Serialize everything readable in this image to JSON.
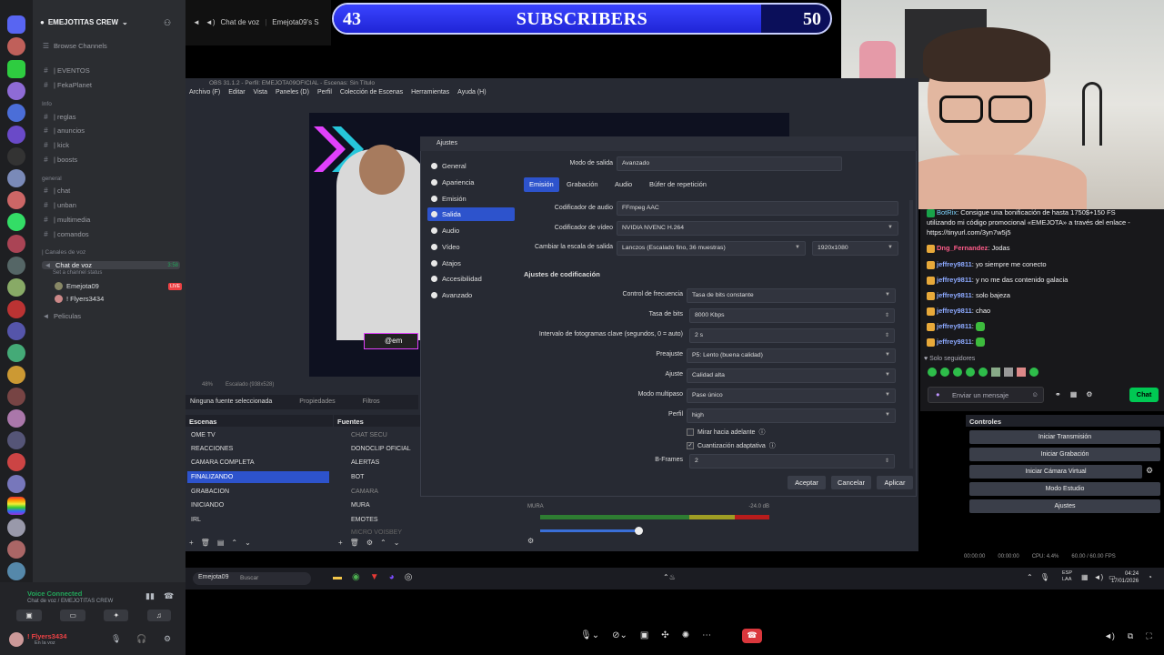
{
  "discord": {
    "server_name": "EMEJOTITAS CREW",
    "browse_channels": "Browse Channels",
    "channels_top": [
      "| EVENTOS",
      "| FekaPlanet"
    ],
    "cat_info": "Info",
    "channels_info": [
      "| reglas",
      "| anuncios",
      "| kick",
      "| boosts"
    ],
    "cat_general": "general",
    "channels_general": [
      "| chat",
      "| unban",
      "| multimedia",
      "| comandos"
    ],
    "cat_voice": "| Canales de voz",
    "voice_channel": "Chat de voz",
    "voice_channel_time": "3:58",
    "channel_status": "Set a channel status",
    "voice_users": [
      {
        "name": "Emejota09",
        "badge": "LIVE"
      },
      {
        "name": "! Flyers3434",
        "badge": ""
      }
    ],
    "extra_channel": "Peliculas",
    "voice_connected": "Voice Connected",
    "voice_path": "Chat de voz / EMEJOTITAS CREW",
    "self_name": "! Flyers3434",
    "self_status": "En la voz"
  },
  "call_bar": {
    "title": "Chat de voz",
    "user": "Emejota09's S"
  },
  "subs_goal": {
    "label": "SUBSCRIBERS",
    "current": "43",
    "target": "50",
    "progress": 0.86
  },
  "obs": {
    "title": "OBS 31.1.2 - Perfil: EMEJOTA09OFICIAL - Escenas: Sin Título",
    "menu": [
      "Archivo (F)",
      "Editar",
      "Vista",
      "Paneles (D)",
      "Perfil",
      "Colección de Escenas",
      "Herramientas",
      "Ayuda (H)"
    ],
    "scale_info": "Escalado (938x528)",
    "zoom": "48%",
    "no_source": "Ninguna fuente seleccionada",
    "properties": "Propiedades",
    "filters": "Filtros",
    "scenes_header": "Escenas",
    "scenes": [
      "OME TV",
      "REACCIONES",
      "CAMARA COMPLETA",
      "FINALIZANDO",
      "GRABACION",
      "INICIANDO",
      "IRL"
    ],
    "selected_scene": "FINALIZANDO",
    "sources_header": "Fuentes",
    "sources": [
      "CHAT SECU",
      "DONOCLIP OFICIAL",
      "ALERTAS",
      "BOT",
      "CAMARA",
      "MURA",
      "EMOTES",
      "MICRO VOISBEY"
    ],
    "controls_header": "Controles",
    "controls": [
      "Iniciar Transmisión",
      "Iniciar Grabación",
      "Iniciar Cámara Virtual",
      "Modo Estudio",
      "Ajustes"
    ],
    "mixer_label": "MURA",
    "mixer_db": "-24.0 dB",
    "status": {
      "time1": "00:00:00",
      "time2": "00:00:00",
      "cpu": "CPU: 4.4%",
      "fps": "60.00 / 60.00 FPS"
    },
    "preview_handle": "@em"
  },
  "settings": {
    "title": "Ajustes",
    "nav": [
      "General",
      "Apariencia",
      "Emisión",
      "Salida",
      "Audio",
      "Vídeo",
      "Atajos",
      "Accesibilidad",
      "Avanzado"
    ],
    "selected_nav": "Salida",
    "output_mode_label": "Modo de salida",
    "output_mode": "Avanzado",
    "tabs": [
      "Emisión",
      "Grabación",
      "Audio",
      "Búfer de repetición"
    ],
    "audio_encoder_label": "Codificador de audio",
    "audio_encoder": "FFmpeg AAC",
    "video_encoder_label": "Codificador de vídeo",
    "video_encoder": "NVIDIA NVENC H.264",
    "rescale_label": "Cambiar la escala de salida",
    "rescale_method": "Lanczos (Escalado fino, 36 muestras)",
    "rescale_res": "1920x1080",
    "encoding_header": "Ajustes de codificación",
    "fields": [
      {
        "label": "Control de frecuencia",
        "value": "Tasa de bits constante"
      },
      {
        "label": "Tasa de bits",
        "value": "8000 Kbps"
      },
      {
        "label": "Intervalo de fotogramas clave (segundos, 0 = auto)",
        "value": "2 s"
      },
      {
        "label": "Preajuste",
        "value": "P5: Lento (buena calidad)"
      },
      {
        "label": "Ajuste",
        "value": "Calidad alta"
      },
      {
        "label": "Modo multipaso",
        "value": "Pase único"
      },
      {
        "label": "Perfil",
        "value": "high"
      }
    ],
    "lookahead": "Mirar hacia adelante",
    "adaptive_quant": "Cuantización adaptativa",
    "bframes_label": "B-Frames",
    "bframes": "2",
    "btn_accept": "Aceptar",
    "btn_cancel": "Cancelar",
    "btn_apply": "Aplicar"
  },
  "chat": {
    "messages": [
      {
        "user": "BotRix",
        "text": "Consigue una bonificación de hasta 1750$+150 FS utilizando mi código promocional «EMEJOTA» a través del enlace - https://tinyurl.com/3yn7w5j5"
      },
      {
        "user": "Dng_Fernandez",
        "text": "Jodas"
      },
      {
        "user": "jeffrey9811",
        "text": "yo siempre me conecto"
      },
      {
        "user": "jeffrey9811",
        "text": "y no me das contenido galacia"
      },
      {
        "user": "jeffrey9811",
        "text": "solo bajeza"
      },
      {
        "user": "jeffrey9811",
        "text": "chao"
      },
      {
        "user": "jeffrey9811",
        "text": ""
      },
      {
        "user": "jeffrey9811",
        "text": ""
      }
    ],
    "followers_only": "Solo seguidores",
    "placeholder": "Enviar un mensaje",
    "send": "Chat"
  },
  "taskbar": {
    "app": "Emejota09",
    "search": "Buscar",
    "lang": "ESP\nLAA",
    "time": "04:24",
    "date": "17/01/2026"
  },
  "colors": {
    "accent": "#2d53cc",
    "twitch": "#9147ff",
    "chat_send": "#00c853",
    "live": "#ed4245"
  }
}
